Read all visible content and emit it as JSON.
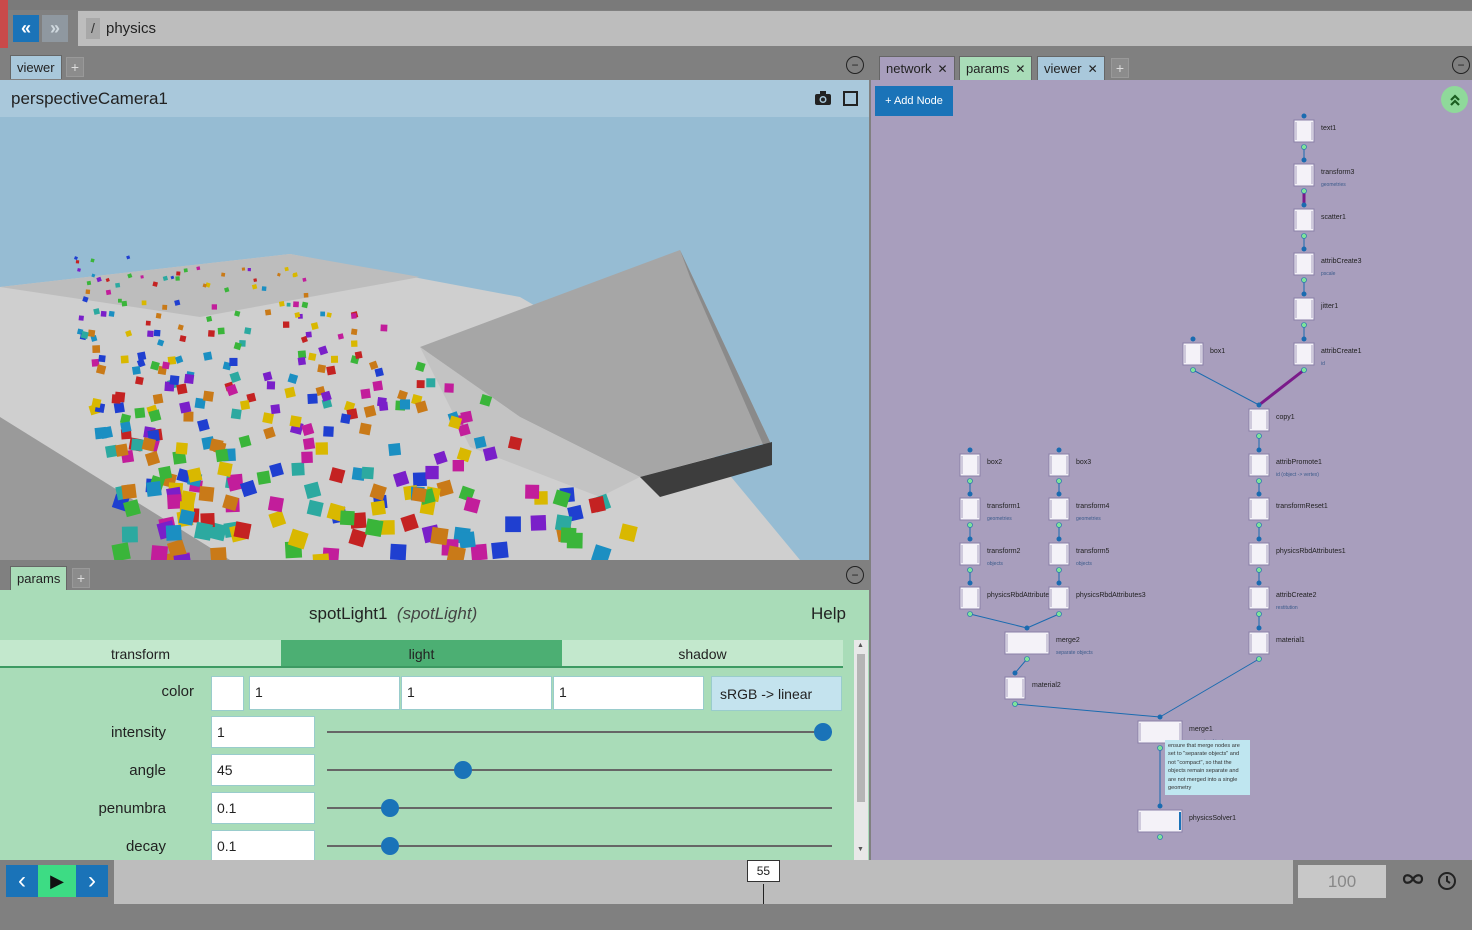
{
  "topbar": {
    "back_glyph": "«",
    "forward_glyph": "»",
    "path_root": "/",
    "path": "physics"
  },
  "viewer_pane": {
    "tabs": [
      {
        "label": "viewer"
      }
    ],
    "add_tab": "+",
    "minimize": "−",
    "camera_name": "perspectiveCamera1"
  },
  "params_pane": {
    "tabs": [
      {
        "label": "params"
      }
    ],
    "add_tab": "+",
    "minimize": "−",
    "node_name": "spotLight1",
    "node_type": "(spotLight)",
    "help": "Help",
    "sections": [
      "transform",
      "light",
      "shadow"
    ],
    "active_section": "light",
    "color": {
      "label": "color",
      "r": "1",
      "g": "1",
      "b": "1",
      "convert_button": "sRGB -> linear",
      "swatch": "#ffffff"
    },
    "params": [
      {
        "label": "intensity",
        "value": "1",
        "slider_fraction": 1.0
      },
      {
        "label": "angle",
        "value": "45",
        "slider_fraction": 0.26
      },
      {
        "label": "penumbra",
        "value": "0.1",
        "slider_fraction": 0.11
      },
      {
        "label": "decay",
        "value": "0.1",
        "slider_fraction": 0.11
      }
    ]
  },
  "network_pane": {
    "tabs": [
      {
        "label": "network",
        "close": "✕"
      },
      {
        "label": "params",
        "close": "✕"
      },
      {
        "label": "viewer",
        "close": "✕"
      }
    ],
    "add_tab": "+",
    "minimize": "−",
    "add_node_button": "+ Add Node",
    "collapse_icon": "double-chevron-up-icon",
    "nodes": [
      {
        "name": "text1",
        "sub": ""
      },
      {
        "name": "transform3",
        "sub": "geometries"
      },
      {
        "name": "scatter1",
        "sub": ""
      },
      {
        "name": "attribCreate3",
        "sub": "pscale"
      },
      {
        "name": "jitter1",
        "sub": ""
      },
      {
        "name": "box1",
        "sub": ""
      },
      {
        "name": "attribCreate1",
        "sub": "id"
      },
      {
        "name": "copy1",
        "sub": ""
      },
      {
        "name": "attribPromote1",
        "sub": "id (object -> vertex)"
      },
      {
        "name": "transformReset1",
        "sub": ""
      },
      {
        "name": "physicsRbdAttributes1",
        "sub": ""
      },
      {
        "name": "attribCreate2",
        "sub": "restitution"
      },
      {
        "name": "material1",
        "sub": ""
      },
      {
        "name": "box2",
        "sub": ""
      },
      {
        "name": "transform1",
        "sub": "geometries"
      },
      {
        "name": "transform2",
        "sub": "objects"
      },
      {
        "name": "physicsRbdAttributes2",
        "sub": ""
      },
      {
        "name": "box3",
        "sub": ""
      },
      {
        "name": "transform4",
        "sub": "geometries"
      },
      {
        "name": "transform5",
        "sub": "objects"
      },
      {
        "name": "physicsRbdAttributes3",
        "sub": ""
      },
      {
        "name": "merge2",
        "sub": "separate objects"
      },
      {
        "name": "material2",
        "sub": ""
      },
      {
        "name": "merge1",
        "sub": "separate objects"
      },
      {
        "name": "physicsSolver1",
        "sub": ""
      }
    ],
    "note": "ensure that merge nodes are set to \"separate objects\" and not \"compact\", so that the objects remain separate and are not merged into a single geometry"
  },
  "timeline": {
    "prev_glyph": "‹",
    "play_glyph": "▶",
    "next_glyph": "›",
    "current_frame": "55",
    "end_frame": "100",
    "loop_icon": "infinity-icon",
    "clock_icon": "clock-icon",
    "current_fraction": 0.55
  },
  "colors": {
    "accent_blue": "#1a73b8",
    "params_bg": "#a9dcb8",
    "active_tab": "#4caf73",
    "network_bg": "#a89ebd",
    "play_green": "#3ddc84"
  }
}
